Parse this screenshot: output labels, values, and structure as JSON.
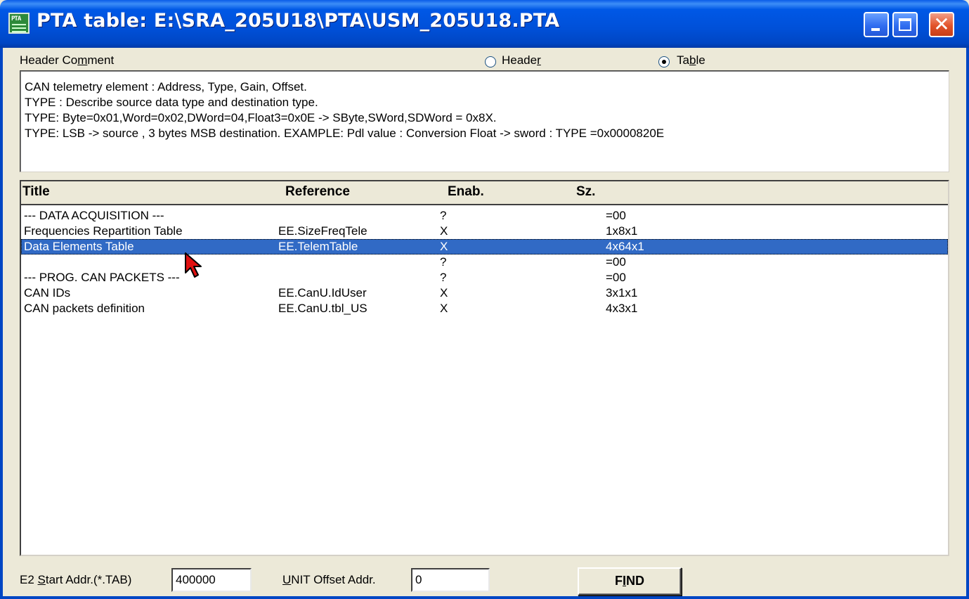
{
  "window": {
    "title": "PTA table: E:\\SRA_205U18\\PTA\\USM_205U18.PTA",
    "icon": "pta-file-icon",
    "icon_text": "PTA"
  },
  "header_comment": {
    "label_pre": "Header Co",
    "label_ul": "m",
    "label_post": "ment",
    "lines": [
      "CAN telemetry element : Address, Type, Gain, Offset.",
      "TYPE : Describe source data type and destination type.",
      "TYPE: Byte=0x01,Word=0x02,DWord=04,Float3=0x0E -> SByte,SWord,SDWord = 0x8X.",
      "TYPE: LSB -> source , 3 bytes MSB destination.  EXAMPLE: Pdl value : Conversion Float -> sword : TYPE =0x0000820E"
    ]
  },
  "view_mode": {
    "header_pre": "Heade",
    "header_ul": "r",
    "table_pre": "Ta",
    "table_ul": "b",
    "table_post": "le",
    "selected": "table"
  },
  "table": {
    "columns": [
      "Title",
      "Reference",
      "Enab.",
      "Sz."
    ],
    "rows": [
      {
        "title": "--- DATA ACQUISITION ---",
        "reference": "",
        "enab": "?",
        "size": "=00"
      },
      {
        "title": "Frequencies Repartition Table",
        "reference": "EE.SizeFreqTele",
        "enab": "X",
        "size": "1x8x1"
      },
      {
        "title": "Data Elements Table",
        "reference": "EE.TelemTable",
        "enab": "X",
        "size": "4x64x1"
      },
      {
        "title": "",
        "reference": "",
        "enab": "?",
        "size": "=00"
      },
      {
        "title": "--- PROG. CAN PACKETS ---",
        "reference": "",
        "enab": "?",
        "size": "=00"
      },
      {
        "title": "CAN IDs",
        "reference": "EE.CanU.IdUser",
        "enab": "X",
        "size": "3x1x1"
      },
      {
        "title": "CAN packets definition",
        "reference": "EE.CanU.tbl_US",
        "enab": "X",
        "size": "4x3x1"
      }
    ],
    "selected_index": 2
  },
  "bottom": {
    "e2_label_pre": "E2 ",
    "e2_label_ul": "S",
    "e2_label_post": "tart Addr.(*.TAB)",
    "e2_value": "400000",
    "unit_label_ul": "U",
    "unit_label_post": "NIT Offset Addr.",
    "unit_value": "0",
    "find_pre": "F",
    "find_ul": "I",
    "find_post": "ND"
  },
  "colors": {
    "titlebar": "#0050d8",
    "selection": "#316ac5",
    "face": "#ece9d8",
    "close_button": "#e2532a"
  }
}
